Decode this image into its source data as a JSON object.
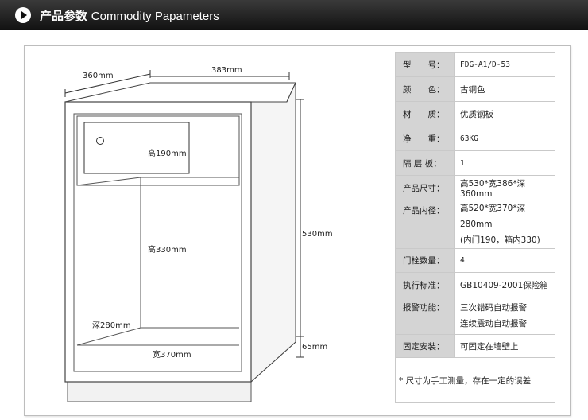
{
  "header": {
    "title_cn": "产品参数",
    "title_en": "Commodity Papameters",
    "icon": "play-circle-icon"
  },
  "diagram": {
    "dim_width": "383mm",
    "dim_depth": "360mm",
    "dim_height": "530mm",
    "dim_base": "65mm",
    "inner_door_height": "高190mm",
    "inner_height": "高330mm",
    "inner_depth": "深280mm",
    "inner_width": "宽370mm"
  },
  "specs": [
    {
      "label": "型　　号：",
      "value": [
        "FDG-A1/D-53"
      ],
      "mono": true
    },
    {
      "label": "颜　　色：",
      "value": [
        "古铜色"
      ]
    },
    {
      "label": "材　　质：",
      "value": [
        "优质钢板"
      ]
    },
    {
      "label": "净　　重：",
      "value": [
        "63KG"
      ],
      "mono": true
    },
    {
      "label": "隔 层 板：",
      "value": [
        "1"
      ],
      "mono": true
    },
    {
      "label": "产品尺寸：",
      "value": [
        "高530*宽386*深360mm"
      ]
    },
    {
      "label": "产品内径：",
      "value": [
        "高520*宽370*深280mm",
        "(内门190，箱内330)"
      ]
    },
    {
      "label": "门栓数量：",
      "value": [
        "4"
      ],
      "mono": true
    },
    {
      "label": "执行标准：",
      "value": [
        "GB10409-2001保险箱"
      ]
    },
    {
      "label": "报警功能：",
      "value": [
        "三次错码自动报警",
        "连续震动自动报警"
      ]
    },
    {
      "label": "固定安装：",
      "value": [
        "可固定在墙壁上"
      ]
    }
  ],
  "note": "* 尺寸为手工测量，存在一定的误差"
}
